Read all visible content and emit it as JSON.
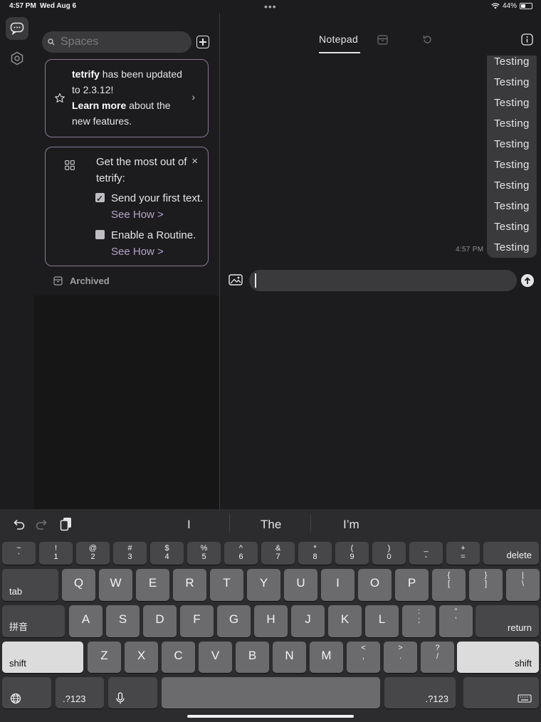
{
  "status_bar": {
    "time": "4:57 PM",
    "date": "Wed Aug 6",
    "dots": "•••",
    "battery": "44%",
    "battery_level": 0.44
  },
  "sidebar": {
    "search_placeholder": "Spaces",
    "update_card": {
      "brand": "tetrify",
      "line1_rest": " has been updated to 2.3.12!",
      "learn_more": "Learn more",
      "line2_rest": " about the new features."
    },
    "onboarding_card": {
      "title": "Get the most out of tetrify:",
      "close": "×",
      "tasks": [
        {
          "label": "Send your first text. ",
          "link": "See How >",
          "checked": true
        },
        {
          "label": "Enable a Routine. ",
          "link": "See How >",
          "checked": false
        }
      ]
    },
    "archived_label": "Archived"
  },
  "main": {
    "tab_notepad": "Notepad",
    "messages": [
      "Testing",
      "Testing",
      "Testing",
      "Testing",
      "Testing",
      "Testing",
      "Testing",
      "Testing",
      "Testing",
      "Testing"
    ],
    "message_time": "4:57 PM"
  },
  "keyboard": {
    "suggestions": [
      "I",
      "The",
      "I’m"
    ],
    "row1": [
      {
        "top": "~",
        "bot": "`"
      },
      {
        "top": "!",
        "bot": "1"
      },
      {
        "top": "@",
        "bot": "2"
      },
      {
        "top": "#",
        "bot": "3"
      },
      {
        "top": "$",
        "bot": "4"
      },
      {
        "top": "%",
        "bot": "5"
      },
      {
        "top": "^",
        "bot": "6"
      },
      {
        "top": "&",
        "bot": "7"
      },
      {
        "top": "*",
        "bot": "8"
      },
      {
        "top": "(",
        "bot": "9"
      },
      {
        "top": ")",
        "bot": "0"
      },
      {
        "top": "_",
        "bot": "-"
      },
      {
        "top": "+",
        "bot": "="
      }
    ],
    "delete": "delete",
    "tab": "tab",
    "row2": [
      "Q",
      "W",
      "E",
      "R",
      "T",
      "Y",
      "U",
      "I",
      "O",
      "P"
    ],
    "row2_sym": [
      {
        "top": "{",
        "bot": "["
      },
      {
        "top": "}",
        "bot": "]"
      },
      {
        "top": "|",
        "bot": "\\"
      }
    ],
    "pinyin": "拼音",
    "row3": [
      "A",
      "S",
      "D",
      "F",
      "G",
      "H",
      "J",
      "K",
      "L"
    ],
    "row3_sym": [
      {
        "top": ":",
        "bot": ";"
      },
      {
        "top": "”",
        "bot": "’"
      }
    ],
    "return": "return",
    "shift": "shift",
    "row4": [
      "Z",
      "X",
      "C",
      "V",
      "B",
      "N",
      "M"
    ],
    "row4_sym": [
      {
        "top": "<",
        "bot": ","
      },
      {
        "top": ">",
        "bot": "."
      },
      {
        "top": "?",
        "bot": "/"
      }
    ],
    "num_switch": ".?123"
  }
}
